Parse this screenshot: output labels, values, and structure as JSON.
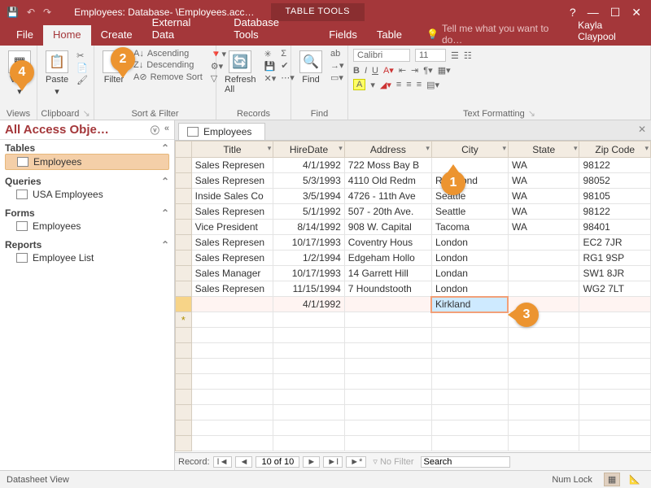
{
  "titlebar": {
    "title": "Employees: Database- \\Employees.acc…",
    "tabletools": "Table Tools",
    "user_short": "Kayla Claypool"
  },
  "tabs": {
    "file": "File",
    "home": "Home",
    "create": "Create",
    "external": "External Data",
    "dbtools": "Database Tools",
    "fields": "Fields",
    "table": "Table",
    "tellme": "Tell me what you want to do…"
  },
  "ribbon": {
    "views": {
      "label": "Views",
      "view": "View"
    },
    "clipboard": {
      "label": "Clipboard",
      "paste": "Paste"
    },
    "sortfilter": {
      "label": "Sort & Filter",
      "filter": "Filter",
      "asc": "Ascending",
      "desc": "Descending",
      "remove": "Remove Sort"
    },
    "records": {
      "label": "Records",
      "refresh": "Refresh\nAll"
    },
    "find": {
      "label": "Find",
      "find": "Find"
    },
    "textfmt": {
      "label": "Text Formatting",
      "font": "Calibri",
      "size": "11"
    }
  },
  "nav": {
    "title": "All Access Obje…",
    "groups": [
      {
        "h": "Tables",
        "items": [
          {
            "label": "Employees",
            "sel": true
          }
        ]
      },
      {
        "h": "Queries",
        "items": [
          {
            "label": "USA Employees"
          }
        ]
      },
      {
        "h": "Forms",
        "items": [
          {
            "label": "Employees"
          }
        ]
      },
      {
        "h": "Reports",
        "items": [
          {
            "label": "Employee List"
          }
        ]
      }
    ]
  },
  "doc": {
    "tab": "Employees",
    "columns": [
      "Title",
      "HireDate",
      "Address",
      "City",
      "State",
      "Zip Code"
    ],
    "rows": [
      {
        "title": "Sales Represen",
        "hire": "4/1/1992",
        "addr": "722 Moss Bay B",
        "city": "",
        "state": "WA",
        "zip": "98122"
      },
      {
        "title": "Sales Represen",
        "hire": "5/3/1993",
        "addr": "4110 Old Redm",
        "city": "Redmond",
        "state": "WA",
        "zip": "98052"
      },
      {
        "title": "Inside Sales Co",
        "hire": "3/5/1994",
        "addr": "4726 - 11th Ave",
        "city": "Seattle",
        "state": "WA",
        "zip": "98105"
      },
      {
        "title": "Sales Represen",
        "hire": "5/1/1992",
        "addr": "507 - 20th Ave.",
        "city": "Seattle",
        "state": "WA",
        "zip": "98122"
      },
      {
        "title": "Vice President",
        "hire": "8/14/1992",
        "addr": "908 W. Capital",
        "city": "Tacoma",
        "state": "WA",
        "zip": "98401"
      },
      {
        "title": "Sales Represen",
        "hire": "10/17/1993",
        "addr": "Coventry Hous",
        "city": "London",
        "state": "",
        "zip": "EC2 7JR"
      },
      {
        "title": "Sales Represen",
        "hire": "1/2/1994",
        "addr": "Edgeham Hollo",
        "city": "London",
        "state": "",
        "zip": "RG1 9SP"
      },
      {
        "title": "Sales Manager",
        "hire": "10/17/1993",
        "addr": "14 Garrett Hill",
        "city": "Londan",
        "state": "",
        "zip": "SW1 8JR"
      },
      {
        "title": "Sales Represen",
        "hire": "11/15/1994",
        "addr": "7 Houndstooth",
        "city": "London",
        "state": "",
        "zip": "WG2 7LT"
      }
    ],
    "editrow": {
      "title": "",
      "hire": "4/1/1992",
      "addr": "",
      "city": "Kirkland",
      "state": "",
      "zip": ""
    },
    "recnav": {
      "label": "Record:",
      "pos": "10 of 10",
      "nofilter": "No Filter",
      "search": "Search"
    }
  },
  "status": {
    "left": "Datasheet View",
    "numlock": "Num Lock"
  },
  "callouts": {
    "1": "1",
    "2": "2",
    "3": "3",
    "4": "4"
  }
}
